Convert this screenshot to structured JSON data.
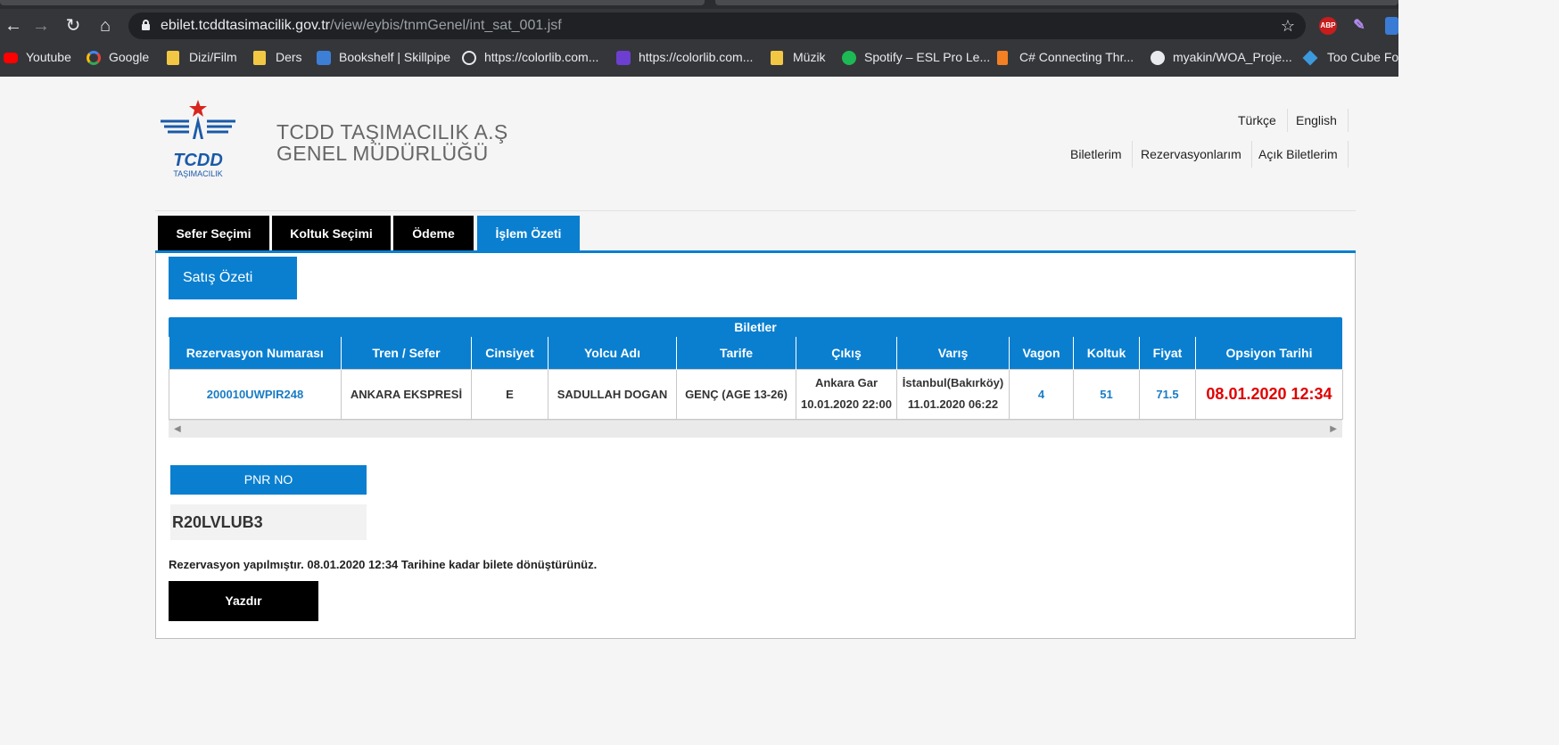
{
  "browser": {
    "url_host": "ebilet.tcddtasimacilik.gov.tr",
    "url_path": "/view/eybis/tnmGenel/int_sat_001.jsf",
    "extensions": {
      "abp_label": "ABP"
    },
    "bookmarks": [
      {
        "label": "Youtube",
        "icon": "youtube-icon"
      },
      {
        "label": "Google",
        "icon": "google-icon"
      },
      {
        "label": "Dizi/Film",
        "icon": "folder-icon"
      },
      {
        "label": "Ders",
        "icon": "folder-icon"
      },
      {
        "label": "Bookshelf | Skillpipe",
        "icon": "book-icon"
      },
      {
        "label": "https://colorlib.com...",
        "icon": "globe-icon"
      },
      {
        "label": "https://colorlib.com...",
        "icon": "colorlib-icon"
      },
      {
        "label": "Müzik",
        "icon": "folder-icon"
      },
      {
        "label": "Spotify – ESL Pro Le...",
        "icon": "spotify-icon"
      },
      {
        "label": "C# Connecting Thr...",
        "icon": "stackoverflow-icon"
      },
      {
        "label": "myakin/WOA_Proje...",
        "icon": "github-icon"
      },
      {
        "label": "Too Cube For",
        "icon": "visual-studio-icon"
      }
    ]
  },
  "header": {
    "logo_text": "TCDD",
    "logo_sub": "TAŞIMACILIK",
    "company_line1": "TCDD TAŞIMACILIK A.Ş",
    "company_line2": "GENEL MÜDÜRLÜĞÜ",
    "languages": [
      "Türkçe",
      "English"
    ],
    "menu": [
      "Biletlerim",
      "Rezervasyonlarım",
      "Açık Biletlerim"
    ]
  },
  "steps": [
    {
      "label": "Sefer Seçimi",
      "active": false
    },
    {
      "label": "Koltuk Seçimi",
      "active": false
    },
    {
      "label": "Ödeme",
      "active": false
    },
    {
      "label": "İşlem Özeti",
      "active": true
    }
  ],
  "summary": {
    "title": "Satış Özeti",
    "table_title": "Biletler",
    "columns": [
      "Rezervasyon Numarası",
      "Tren / Sefer",
      "Cinsiyet",
      "Yolcu Adı",
      "Tarife",
      "Çıkış",
      "Varış",
      "Vagon",
      "Koltuk",
      "Fiyat",
      "Opsiyon Tarihi"
    ],
    "row": {
      "rezervasyon": "200010UWPIR248",
      "tren": "ANKARA EKSPRESİ",
      "cinsiyet": "E",
      "yolcu": "SADULLAH DOGAN",
      "tarife": "GENÇ (AGE 13-26)",
      "cikis_yer": "Ankara Gar",
      "cikis_zaman": "10.01.2020 22:00",
      "varis_yer": "İstanbul(Bakırköy)",
      "varis_zaman": "11.01.2020 06:22",
      "vagon": "4",
      "koltuk": "51",
      "fiyat": "71.5",
      "opsiyon": "08.01.2020 12:34"
    }
  },
  "pnr": {
    "label": "PNR NO",
    "value": "R20LVLUB3"
  },
  "note": "Rezervasyon yapılmıştır. 08.01.2020 12:34 Tarihine kadar bilete dönüştürünüz.",
  "print_label": "Yazdır",
  "colors": {
    "primary_blue": "#0a7fd0",
    "black_tab": "#000000",
    "option_red": "#e00000",
    "logo_red": "#d7261e",
    "logo_blue": "#1a5aa8"
  }
}
